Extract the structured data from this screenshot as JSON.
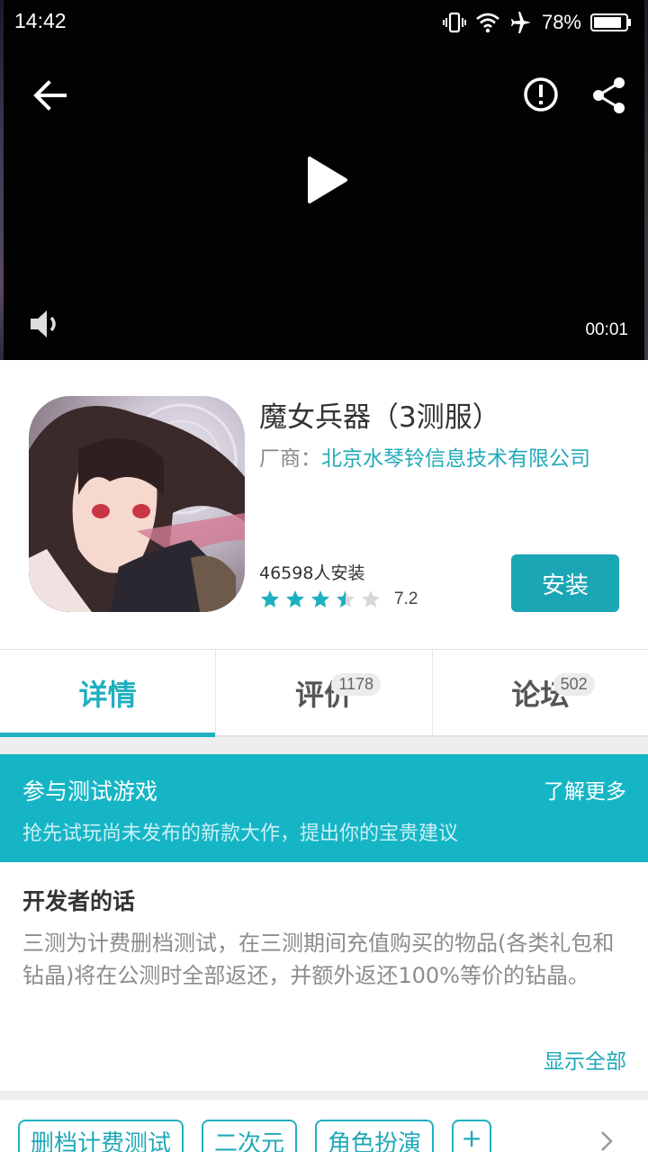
{
  "status_bar": {
    "time": "14:42",
    "battery": "78%"
  },
  "video": {
    "timestamp": "00:01"
  },
  "icons": {
    "back": "back-arrow-icon",
    "report": "exclamation-icon",
    "share": "share-icon",
    "play": "play-icon",
    "volume": "volume-icon",
    "vibrate": "vibrate-icon",
    "wifi": "wifi-icon",
    "airplane": "airplane-icon",
    "battery": "battery-icon",
    "chevron": "chevron-right-icon"
  },
  "app": {
    "title": "魔女兵器（3测服）",
    "vendor_label": "厂商：",
    "vendor_name": "北京水琴铃信息技术有限公司",
    "installs": "46598人安装",
    "rating": "7.2",
    "rating_stars": 3.5,
    "install_label": "安装"
  },
  "tabs": [
    {
      "label": "详情",
      "badge": ""
    },
    {
      "label": "评价",
      "badge": "1178"
    },
    {
      "label": "论坛",
      "badge": "502"
    }
  ],
  "beta": {
    "title": "参与测试游戏",
    "more": "了解更多",
    "desc": "抢先试玩尚未发布的新款大作，提出你的宝贵建议"
  },
  "developer": {
    "title": "开发者的话",
    "text": "三测为计费删档测试，在三测期间充值购买的物品(各类礼包和钻晶)将在公测时全部返还，并额外返还100%等价的钻晶。",
    "show_all": "显示全部"
  },
  "tags": [
    "删档计费测试",
    "二次元",
    "角色扮演",
    "+"
  ],
  "colors": {
    "accent": "#1fb0c0",
    "banner": "#16b5c6",
    "button": "#1aa6b5"
  }
}
